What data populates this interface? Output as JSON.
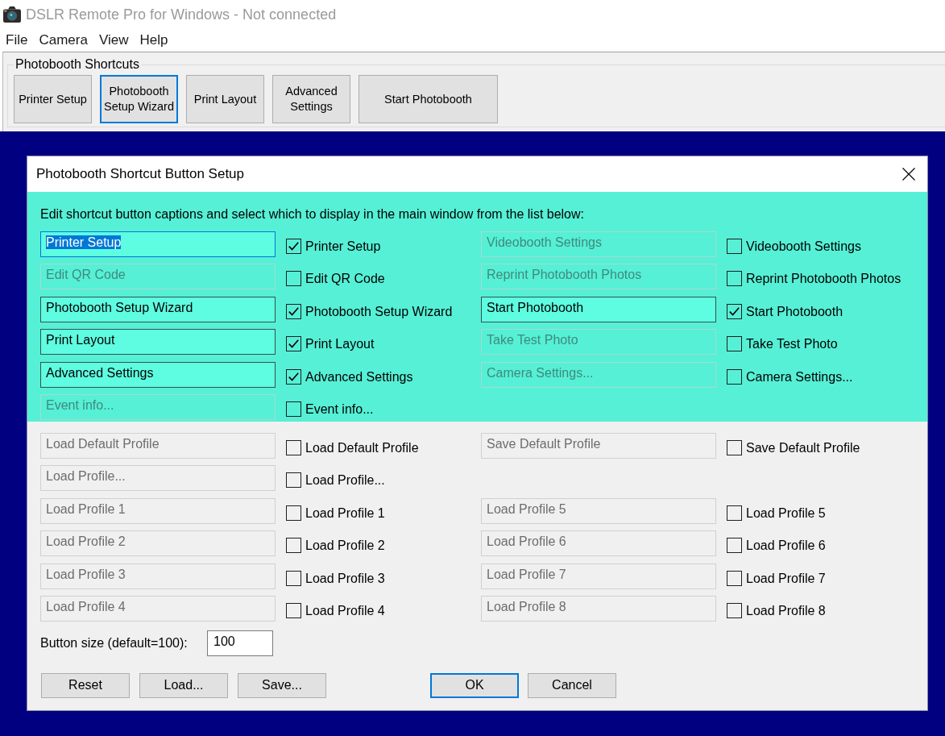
{
  "window": {
    "title": "DSLR Remote Pro for Windows - Not connected"
  },
  "menu": [
    "File",
    "Camera",
    "View",
    "Help"
  ],
  "shortcuts_panel": {
    "title": "Photobooth Shortcuts",
    "buttons": [
      {
        "label": "Printer Setup",
        "focused": false
      },
      {
        "label": "Photobooth Setup Wizard",
        "focused": true
      },
      {
        "label": "Print Layout",
        "focused": false
      },
      {
        "label": "Advanced Settings",
        "focused": false
      },
      {
        "label": "Start Photobooth",
        "focused": false
      }
    ]
  },
  "dialog": {
    "title": "Photobooth Shortcut Button Setup",
    "sections": [
      {
        "kind": "highlighted",
        "instruction": "Edit shortcut button captions and select which to display in the main window from the list below:",
        "rows": [
          {
            "left": {
              "caption": "Printer Setup",
              "label": "Printer Setup",
              "checked": true,
              "focused": true
            },
            "right": {
              "caption": "Videobooth Settings",
              "label": "Videobooth Settings",
              "checked": false,
              "focused": false
            }
          },
          {
            "left": {
              "caption": "Edit QR Code",
              "label": "Edit QR Code",
              "checked": false,
              "focused": false
            },
            "right": {
              "caption": "Reprint Photobooth Photos",
              "label": "Reprint Photobooth Photos",
              "checked": false,
              "focused": false
            }
          },
          {
            "left": {
              "caption": "Photobooth Setup Wizard",
              "label": "Photobooth Setup Wizard",
              "checked": true,
              "focused": false
            },
            "right": {
              "caption": "Start Photobooth",
              "label": "Start Photobooth",
              "checked": true,
              "focused": false
            }
          },
          {
            "left": {
              "caption": "Print Layout",
              "label": "Print Layout",
              "checked": true,
              "focused": false
            },
            "right": {
              "caption": "Take Test Photo",
              "label": "Take Test Photo",
              "checked": false,
              "focused": false
            }
          },
          {
            "left": {
              "caption": "Advanced Settings",
              "label": "Advanced Settings",
              "checked": true,
              "focused": false
            },
            "right": {
              "caption": "Camera Settings...",
              "label": "Camera Settings...",
              "checked": false,
              "focused": false
            }
          },
          {
            "left": {
              "caption": "Event info...",
              "label": "Event info...",
              "checked": false,
              "focused": false
            }
          }
        ]
      },
      {
        "kind": "plain",
        "rows": [
          {
            "left": {
              "caption": "Load Default Profile",
              "label": "Load Default Profile",
              "checked": false,
              "focused": false
            },
            "right": {
              "caption": "Save Default Profile",
              "label": "Save Default Profile",
              "checked": false,
              "focused": false
            }
          },
          {
            "left": {
              "caption": "Load Profile...",
              "label": "Load Profile...",
              "checked": false,
              "focused": false
            }
          },
          {
            "left": {
              "caption": "Load Profile 1",
              "label": "Load Profile 1",
              "checked": false,
              "focused": false
            },
            "right": {
              "caption": "Load Profile 5",
              "label": "Load Profile 5",
              "checked": false,
              "focused": false
            }
          },
          {
            "left": {
              "caption": "Load Profile 2",
              "label": "Load Profile 2",
              "checked": false,
              "focused": false
            },
            "right": {
              "caption": "Load Profile 6",
              "label": "Load Profile 6",
              "checked": false,
              "focused": false
            }
          },
          {
            "left": {
              "caption": "Load Profile 3",
              "label": "Load Profile 3",
              "checked": false,
              "focused": false
            },
            "right": {
              "caption": "Load Profile 7",
              "label": "Load Profile 7",
              "checked": false,
              "focused": false
            }
          },
          {
            "left": {
              "caption": "Load Profile 4",
              "label": "Load Profile 4",
              "checked": false,
              "focused": false
            },
            "right": {
              "caption": "Load Profile 8",
              "label": "Load Profile 8",
              "checked": false,
              "focused": false
            }
          }
        ]
      }
    ],
    "button_size": {
      "label": "Button size (default=100):",
      "value": "100"
    },
    "file_buttons": [
      {
        "label": "Reset",
        "default": false
      },
      {
        "label": "Load...",
        "default": false
      },
      {
        "label": "Save...",
        "default": false
      }
    ],
    "confirm_buttons": [
      {
        "label": "OK",
        "default": true
      },
      {
        "label": "Cancel",
        "default": false
      }
    ]
  }
}
